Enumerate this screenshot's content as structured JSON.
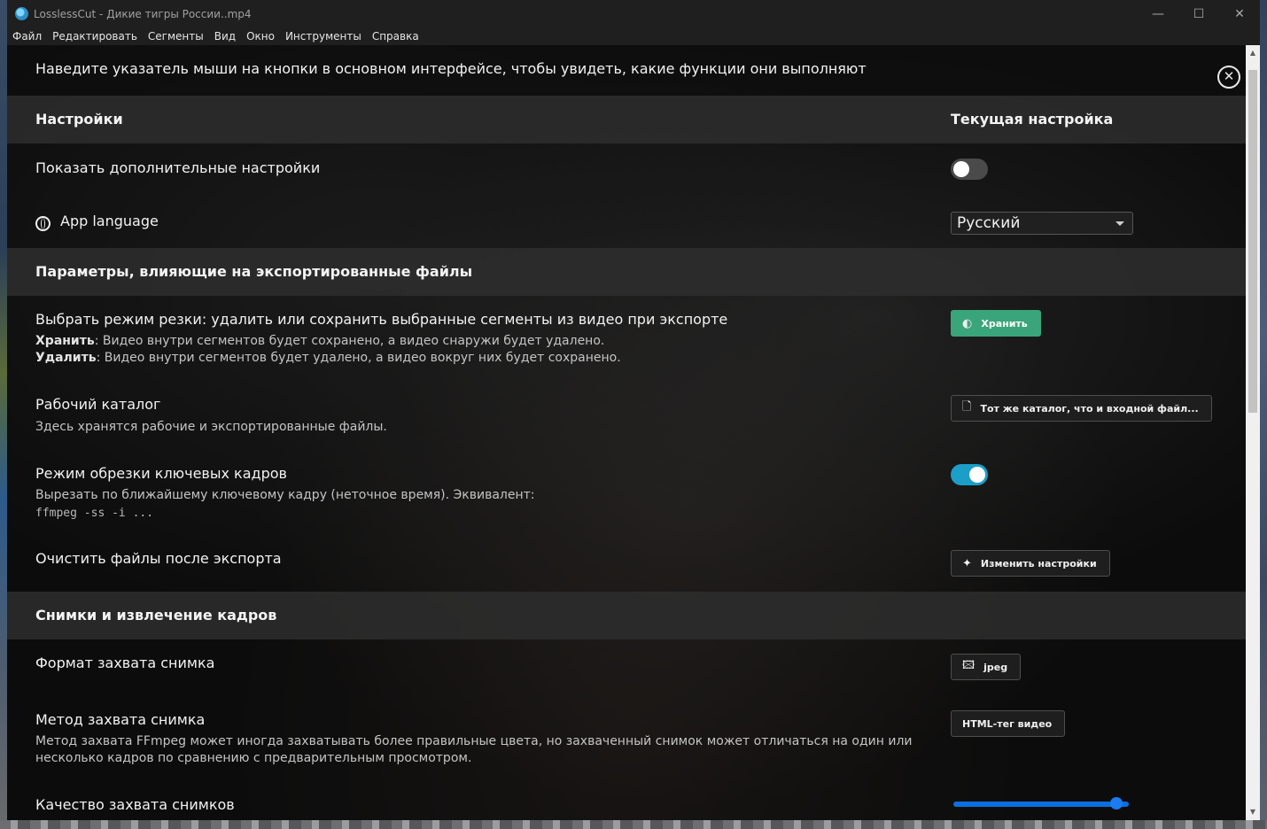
{
  "window": {
    "title": "LosslessCut - Дикие тигры России..mp4",
    "controls": {
      "minimize": "—",
      "maximize": "☐",
      "close": "✕"
    }
  },
  "menu": {
    "file": "Файл",
    "edit": "Редактировать",
    "segments": "Сегменты",
    "view": "Вид",
    "window": "Окно",
    "tools": "Инструменты",
    "help": "Справка"
  },
  "hint": {
    "text": "Наведите указатель мыши на кнопки в основном интерфейсе, чтобы увидеть, какие функции они выполняют",
    "close_glyph": "✕"
  },
  "settings_header": {
    "title": "Настройки",
    "current_title": "Текущая настройка"
  },
  "rows": {
    "advanced": {
      "label": "Показать дополнительные настройки",
      "enabled": false
    },
    "language": {
      "label": "App language",
      "value": "Русский"
    },
    "cut_mode": {
      "label": "Выбрать режим резки: удалить или сохранить выбранные сегменты из видео при экспорте",
      "keep_term": "Хранить",
      "keep_desc": ": Видео внутри сегментов будет сохранено, а видео снаружи будет удалено.",
      "remove_term": "Удалить",
      "remove_desc": ": Видео внутри сегментов будет удалено, а видео вокруг них будет сохранено.",
      "button": "Хранить",
      "button_icon": "◐"
    },
    "working_dir": {
      "label": "Рабочий каталог",
      "desc": "Здесь хранятся рабочие и экспортированные файлы.",
      "button": "Тот же каталог, что и входной файл...",
      "button_icon": "🗋"
    },
    "keyframe_cut": {
      "label": "Режим обрезки ключевых кадров",
      "desc": "Вырезать по ближайшему ключевому кадру (неточное время). Эквивалент:",
      "code": "ffmpeg -ss -i ...",
      "enabled": true
    },
    "cleanup": {
      "label": "Очистить файлы после экспорта",
      "button": "Изменить настройки",
      "button_icon": "✦"
    }
  },
  "export_section": {
    "title": "Параметры, влияющие на экспортированные файлы"
  },
  "snapshot_section": {
    "title": "Снимки и извлечение кадров"
  },
  "snapshot_rows": {
    "format": {
      "label": "Формат захвата снимка",
      "button": "jpeg",
      "button_icon": "🖾"
    },
    "method": {
      "label": "Метод захвата снимка",
      "desc_line1": "Метод захвата FFmpeg может иногда захватывать более правильные цвета, но захваченный снимок может отличаться на один или",
      "desc_line2": "несколько кадров по сравнению с предварительным просмотром.",
      "button": "HTML-тег видео"
    },
    "quality": {
      "label": "Качество захвата снимков",
      "value_fraction": 0.9
    }
  },
  "scrollbar": {
    "up": "▲",
    "down": "▼"
  }
}
